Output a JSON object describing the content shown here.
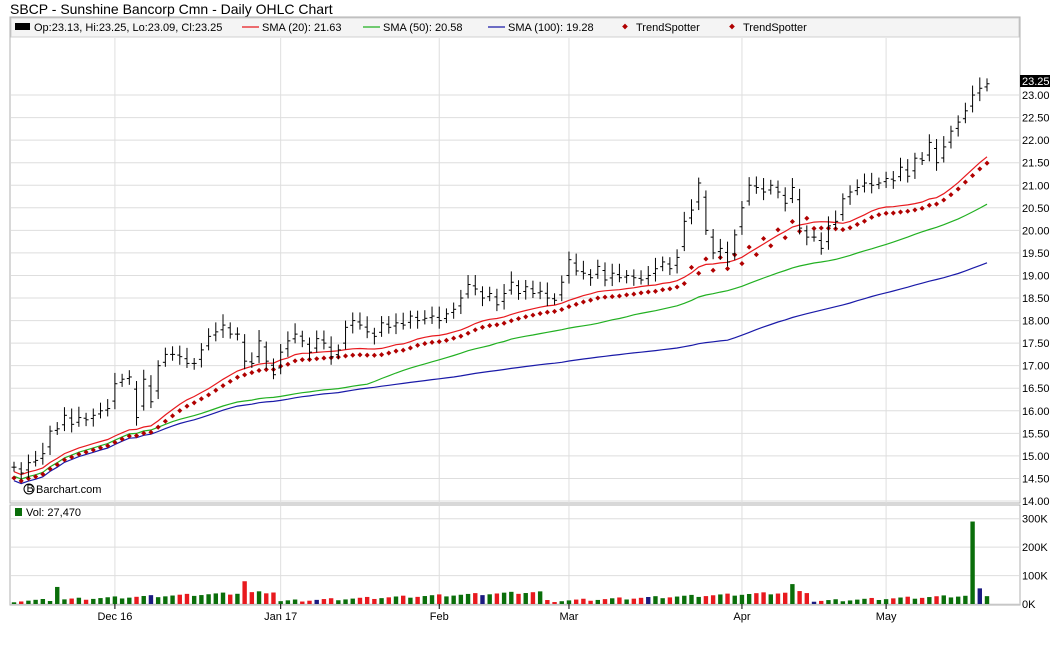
{
  "title": "SBCP - Sunshine Bancorp Cmn - Daily OHLC Chart",
  "watermark": "Barchart.com",
  "legend": {
    "ohlc": "Op:23.13, Hi:23.25, Lo:23.09, Cl:23.25",
    "sma20": "SMA (20): 21.63",
    "sma50": "SMA (50): 20.58",
    "sma100": "SMA (100): 19.28",
    "trend1": "TrendSpotter",
    "trend2": "TrendSpotter"
  },
  "volume_label": "Vol: 27,470",
  "last_price_label": "23.25",
  "colors": {
    "sma20": "#e8191e",
    "sma50": "#22b022",
    "sma100": "#1a1aa8",
    "trend": "#b00000",
    "vol_up": "#0a6e0a",
    "vol_down": "#e8191e",
    "vol_neutral": "#1a1a80",
    "grid": "#dedede"
  },
  "chart_data": [
    {
      "type": "ohlc",
      "title": "SBCP - Sunshine Bancorp Cmn - Daily OHLC Chart",
      "ylim": [
        14.0,
        23.4
      ],
      "y_ticks": [
        "14.00",
        "14.50",
        "15.00",
        "15.50",
        "16.00",
        "16.50",
        "17.00",
        "17.50",
        "18.00",
        "18.50",
        "19.00",
        "19.50",
        "20.00",
        "20.50",
        "21.00",
        "21.50",
        "22.00",
        "22.50",
        "23.00"
      ],
      "x_tick_labels": [
        "Dec 16",
        "Jan 17",
        "Feb",
        "Mar",
        "Apr",
        "May"
      ],
      "x_tick_index": [
        14,
        37,
        59,
        77,
        101,
        121
      ],
      "close": [
        14.75,
        14.62,
        14.85,
        14.9,
        15.05,
        15.55,
        15.6,
        15.9,
        15.7,
        15.85,
        15.8,
        15.9,
        16.0,
        16.05,
        16.6,
        16.7,
        16.75,
        15.85,
        16.7,
        16.2,
        17.0,
        17.25,
        17.25,
        17.2,
        17.05,
        17.05,
        17.35,
        17.65,
        17.75,
        17.9,
        17.7,
        17.7,
        17.1,
        17.05,
        17.55,
        17.1,
        16.8,
        17.3,
        17.55,
        17.7,
        17.55,
        17.3,
        17.6,
        17.5,
        17.2,
        17.35,
        17.85,
        18.0,
        17.9,
        17.75,
        17.65,
        17.95,
        17.85,
        17.95,
        17.9,
        18.1,
        18.0,
        18.05,
        18.1,
        18.0,
        18.15,
        18.25,
        18.5,
        18.8,
        18.7,
        18.5,
        18.6,
        18.35,
        18.6,
        18.85,
        18.6,
        18.75,
        18.6,
        18.65,
        18.5,
        18.45,
        18.85,
        19.35,
        19.1,
        19.05,
        18.95,
        19.2,
        18.9,
        19.05,
        18.95,
        19.0,
        18.95,
        18.9,
        19.0,
        19.15,
        19.3,
        19.15,
        19.4,
        20.2,
        20.45,
        21.05,
        20.0,
        19.5,
        19.6,
        19.3,
        19.9,
        20.5,
        21.0,
        20.95,
        20.85,
        21.0,
        20.85,
        20.6,
        20.95,
        20.05,
        19.85,
        19.85,
        19.6,
        20.1,
        20.2,
        20.7,
        20.85,
        20.95,
        21.05,
        21.0,
        21.05,
        21.15,
        21.1,
        21.4,
        21.2,
        21.6,
        21.55,
        21.95,
        21.5,
        21.85,
        22.2,
        22.4,
        22.65,
        23.0,
        23.15,
        23.25
      ],
      "sma20_endpoints": {
        "start": 14.65,
        "end": 21.63
      },
      "sma50_endpoints": {
        "start": 14.55,
        "end": 20.58
      },
      "sma100_endpoints": {
        "start": 14.45,
        "end": 19.28
      }
    },
    {
      "type": "bar",
      "title": "Vol: 27,470",
      "ylim": [
        0,
        320000
      ],
      "y_ticks": [
        "0K",
        "100K",
        "200K",
        "300K"
      ],
      "highlight": [
        {
          "index": 133,
          "value": 290000
        },
        {
          "index": 6,
          "value": 60000
        },
        {
          "index": 32,
          "value": 80000
        },
        {
          "index": 108,
          "value": 70000
        },
        {
          "index": 134,
          "value": 55000
        }
      ]
    }
  ]
}
